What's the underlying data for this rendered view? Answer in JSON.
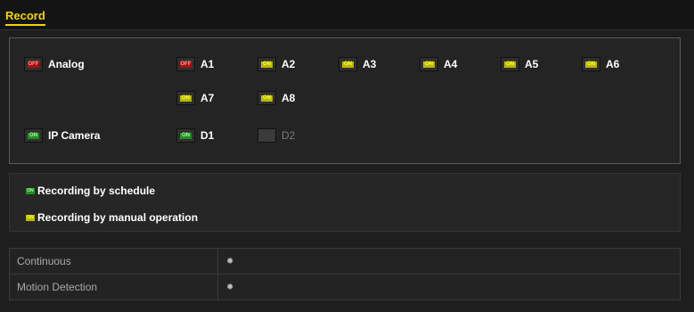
{
  "tabs": {
    "record": "Record"
  },
  "groups": {
    "analog": {
      "label": "Analog",
      "state": "OFF"
    },
    "ip_camera": {
      "label": "IP Camera",
      "state": "ON"
    }
  },
  "analog_channels": [
    {
      "name": "A1",
      "state": "OFF"
    },
    {
      "name": "A2",
      "state": "ON"
    },
    {
      "name": "A3",
      "state": "ON"
    },
    {
      "name": "A4",
      "state": "ON"
    },
    {
      "name": "A5",
      "state": "ON"
    },
    {
      "name": "A6",
      "state": "ON"
    },
    {
      "name": "A7",
      "state": "ON"
    },
    {
      "name": "A8",
      "state": "ON"
    }
  ],
  "ip_channels": [
    {
      "name": "D1",
      "state": "ON"
    },
    {
      "name": "D2",
      "state": ""
    }
  ],
  "legend": {
    "schedule": {
      "badge": "ON",
      "text": "Recording by schedule"
    },
    "manual": {
      "badge": "ON",
      "text": "Recording by manual operation"
    }
  },
  "modes": [
    {
      "name": "Continuous",
      "icon": "gear-icon"
    },
    {
      "name": "Motion Detection",
      "icon": "gear-icon"
    }
  ],
  "colors": {
    "accent": "#f3d500",
    "on_yellow": "#b9b900",
    "on_green": "#1f8f1f",
    "off_red": "#a81010"
  }
}
